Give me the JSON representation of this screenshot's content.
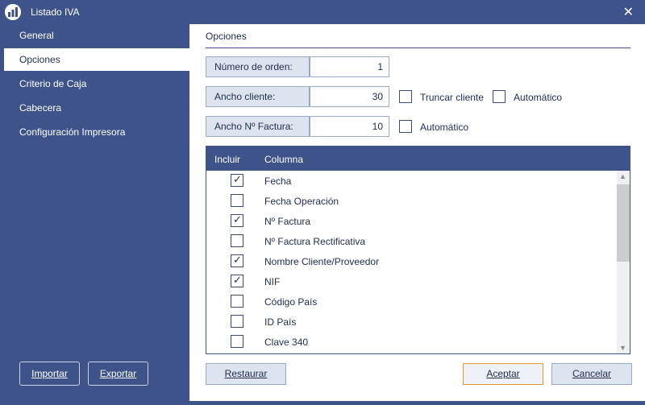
{
  "window": {
    "title": "Listado IVA",
    "close_glyph": "✕"
  },
  "sidebar": {
    "items": [
      {
        "label": "General"
      },
      {
        "label": "Opciones"
      },
      {
        "label": "Criterio de Caja"
      },
      {
        "label": "Cabecera"
      },
      {
        "label": "Configuración Impresora"
      }
    ],
    "active": "Opciones",
    "import_label": "Importar",
    "export_label": "Exportar"
  },
  "main": {
    "section_title": "Opciones",
    "fields": [
      {
        "label": "Número de orden:",
        "value": "1"
      },
      {
        "label": "Ancho cliente:",
        "value": "30"
      },
      {
        "label": "Ancho Nº Factura:",
        "value": "10"
      }
    ],
    "truncar_cliente": {
      "label": "Truncar cliente",
      "checked": false
    },
    "automatico_cliente": {
      "label": "Automático",
      "checked": false
    },
    "automatico_factura": {
      "label": "Automático",
      "checked": false
    },
    "table": {
      "headers": [
        "Incluir",
        "Columna"
      ],
      "rows": [
        {
          "name": "Fecha",
          "checked": true
        },
        {
          "name": "Fecha Operación",
          "checked": false
        },
        {
          "name": "Nº Factura",
          "checked": true
        },
        {
          "name": "Nº Factura Rectificativa",
          "checked": false
        },
        {
          "name": "Nombre Cliente/Proveedor",
          "checked": true
        },
        {
          "name": "NIF",
          "checked": true
        },
        {
          "name": "Código País",
          "checked": false
        },
        {
          "name": "ID País",
          "checked": false
        },
        {
          "name": "Clave 340",
          "checked": false
        }
      ]
    },
    "buttons": {
      "restaurar": "Restaurar",
      "aceptar": "Aceptar",
      "cancelar": "Cancelar"
    }
  },
  "colors": {
    "accent": "#3d5389",
    "primary_border": "#e39a2d"
  },
  "icons": {
    "app": "app-logo-icon",
    "check": "checkmark-icon"
  }
}
